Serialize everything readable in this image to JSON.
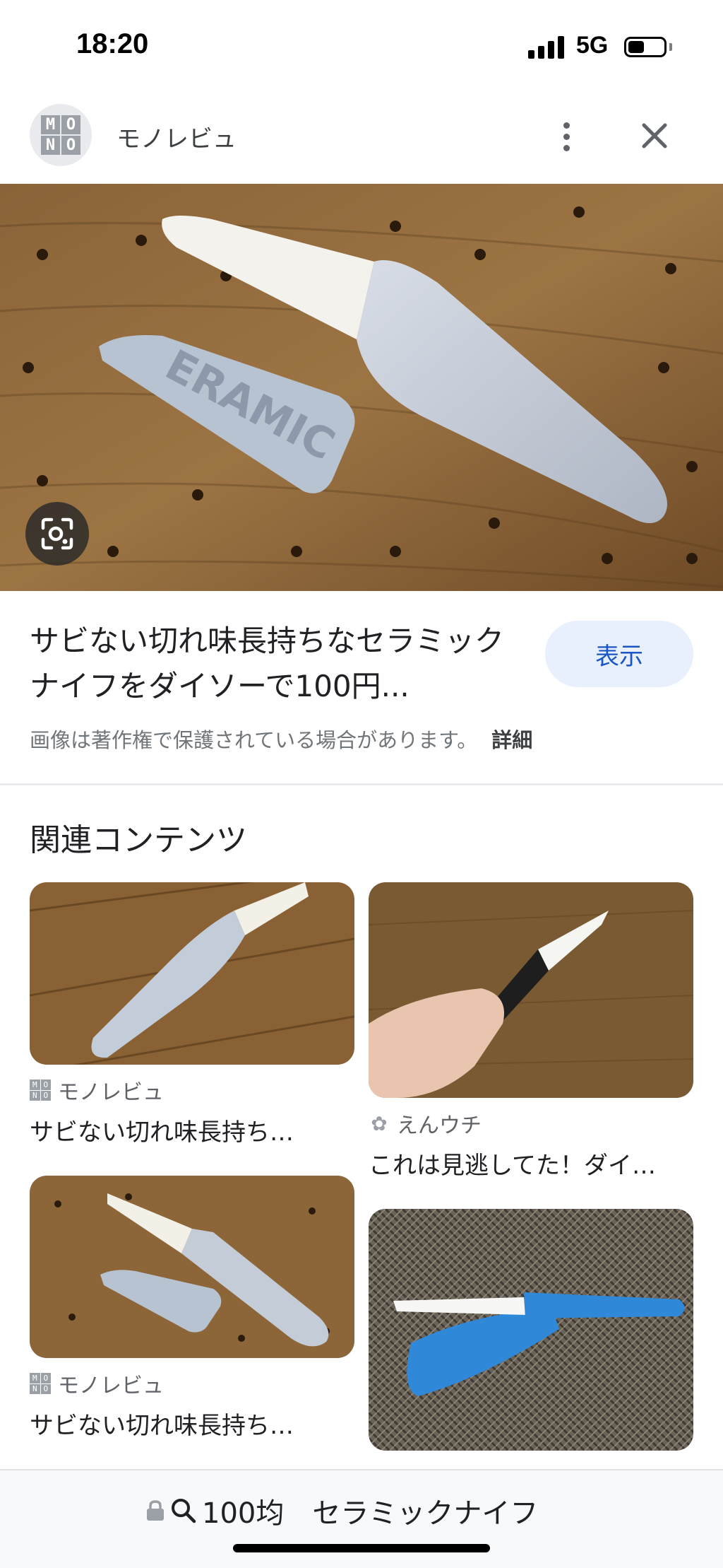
{
  "status_bar": {
    "time": "18:20",
    "network": "5G",
    "battery_level": 0.45
  },
  "header": {
    "site_name": "モノレビュ",
    "logo_letters": [
      "M",
      "O",
      "N",
      "O"
    ]
  },
  "hero": {
    "carved_text": "ERAMIC"
  },
  "result": {
    "title": "サビない切れ味長持ちなセラミックナイフをダイソーで100円...",
    "show_button": "表示",
    "copyright_notice": "画像は著作権で保護されている場合があります。",
    "details_link": "詳細"
  },
  "related": {
    "heading": "関連コンテンツ",
    "items": [
      {
        "source": "モノレビュ",
        "caption": "サビない切れ味長持ち…"
      },
      {
        "source": "えんウチ",
        "caption": "これは見逃してた！ダイ…"
      },
      {
        "source": "モノレビュ",
        "caption": "サビない切れ味長持ち…"
      },
      {
        "source": "",
        "caption": ""
      }
    ]
  },
  "bottom_bar": {
    "query": "100均　セラミックナイフ"
  },
  "colors": {
    "accent": "#1a56c4",
    "button_bg": "#e8f0fe"
  }
}
